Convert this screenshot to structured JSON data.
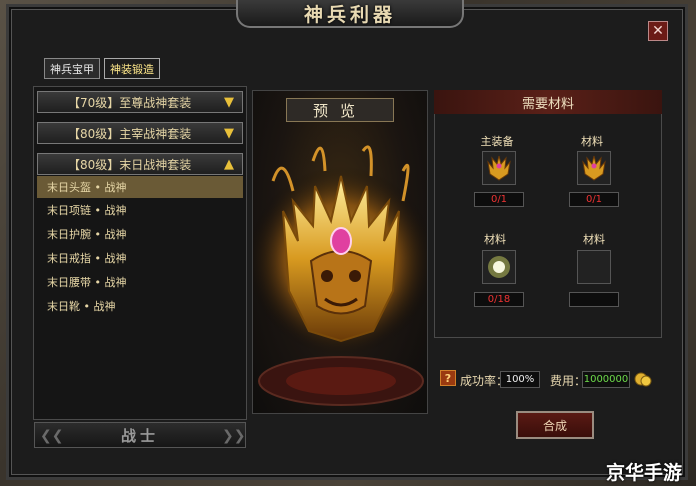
{
  "window": {
    "title": "神兵利器",
    "close_glyph": "✕"
  },
  "tabs": [
    {
      "label": "神兵宝甲",
      "active": false
    },
    {
      "label": "神装锻造",
      "active": true
    }
  ],
  "categories": [
    {
      "label": "【70级】至尊战神套装",
      "arrow": "▼"
    },
    {
      "label": "【80级】主宰战神套装",
      "arrow": "▼"
    },
    {
      "label": "【80级】末日战神套装",
      "arrow": "▲"
    }
  ],
  "items": [
    {
      "label": "末日头盔 • 战神",
      "selected": true
    },
    {
      "label": "末日项链 • 战神",
      "selected": false
    },
    {
      "label": "末日护腕 • 战神",
      "selected": false
    },
    {
      "label": "末日戒指 • 战神",
      "selected": false
    },
    {
      "label": "末日腰带 • 战神",
      "selected": false
    },
    {
      "label": "末日靴 • 战神",
      "selected": false
    }
  ],
  "class_footer": "战士",
  "preview": {
    "title": "预览"
  },
  "materials": {
    "header": "需要材料",
    "slots": [
      {
        "label": "主装备",
        "count": "0/1",
        "icon": "golden-helmet-icon"
      },
      {
        "label": "材料",
        "count": "0/1",
        "icon": "golden-helmet-icon"
      },
      {
        "label": "材料",
        "count": "0/18",
        "icon": "glowing-orb-icon"
      },
      {
        "label": "材料",
        "count": "",
        "icon": "empty-slot"
      }
    ]
  },
  "success_rate": {
    "label": "成功率：",
    "value": "100%"
  },
  "cost": {
    "label": "费用：",
    "value": "1000000"
  },
  "craft_button": "合成",
  "watermark": "京华手游",
  "colors": {
    "accent_gold": "#e8c03a",
    "count_red": "#ee3333",
    "cost_green": "#6ddb4a",
    "header_red": "#5a2018"
  }
}
